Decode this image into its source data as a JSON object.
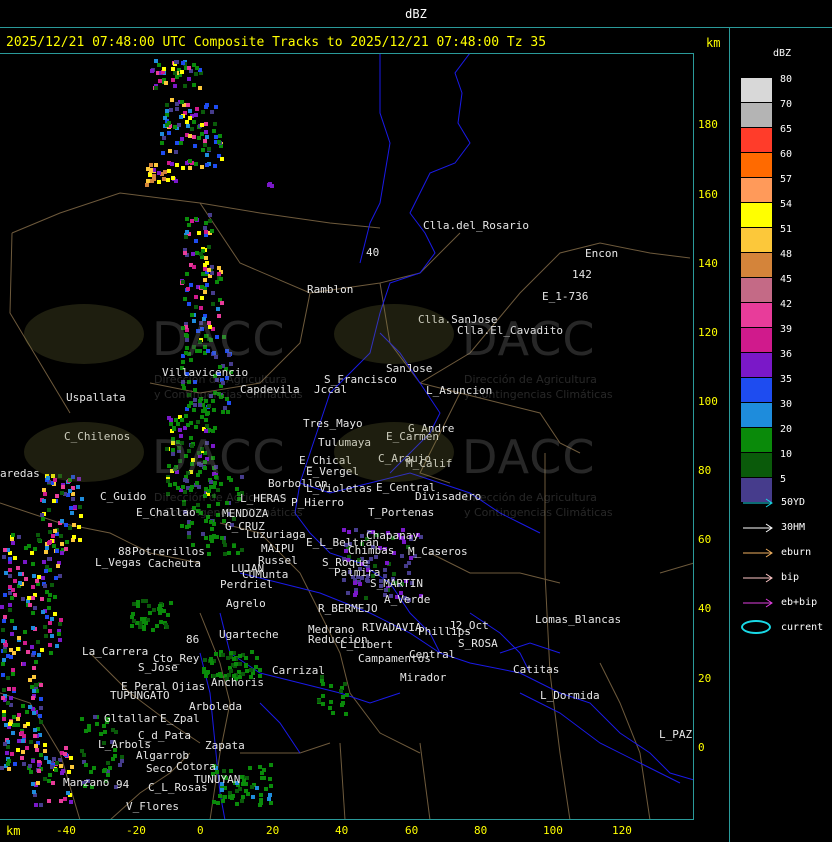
{
  "window_title": "dBZ",
  "header": "2025/12/21 07:48:00 UTC Composite Tracks to 2025/12/21 07:48:00 Tz 35",
  "km_label": "km",
  "y_ticks": [
    "180",
    "160",
    "140",
    "120",
    "100",
    "80",
    "60",
    "40",
    "20",
    "0"
  ],
  "x_ticks": [
    "-40",
    "-20",
    "0",
    "20",
    "40",
    "60",
    "80",
    "100",
    "120"
  ],
  "legend": {
    "title": "dBZ",
    "bins": [
      {
        "label": "80",
        "color": "#d8d8d8"
      },
      {
        "label": "70",
        "color": "#b4b4b4"
      },
      {
        "label": "65",
        "color": "#ff3c2a"
      },
      {
        "label": "60",
        "color": "#ff6a00"
      },
      {
        "label": "57",
        "color": "#ff9a5a"
      },
      {
        "label": "54",
        "color": "#ffff00"
      },
      {
        "label": "51",
        "color": "#fcc83a"
      },
      {
        "label": "48",
        "color": "#d4843a"
      },
      {
        "label": "45",
        "color": "#c46a86"
      },
      {
        "label": "42",
        "color": "#e83c9a"
      },
      {
        "label": "39",
        "color": "#d01a8c"
      },
      {
        "label": "36",
        "color": "#7a18c8"
      },
      {
        "label": "35",
        "color": "#1e4cf0"
      },
      {
        "label": "30",
        "color": "#1e8cdc"
      },
      {
        "label": "20",
        "color": "#0a8a0a"
      },
      {
        "label": "10",
        "color": "#0a5a0a"
      },
      {
        "label": "5",
        "color": "#463c8c"
      }
    ]
  },
  "tracks": [
    {
      "label": "50YD",
      "color": "#19d9e6"
    },
    {
      "label": "30HM",
      "color": "#ffffff"
    },
    {
      "label": "eburn",
      "color": "#f0b060"
    },
    {
      "label": "bip",
      "color": "#ffc8c8"
    },
    {
      "label": "eb+bip",
      "color": "#e040e0"
    }
  ],
  "current_label": "current",
  "watermark": {
    "brand": "DACC",
    "line1": "Dirección de Agricultura",
    "line2": "y Contingencias Climáticas"
  },
  "places": [
    {
      "name": "Clla.del_Rosario"
    },
    {
      "name": "Encon"
    },
    {
      "name": "142"
    },
    {
      "name": "E_1-736"
    },
    {
      "name": "Ramblon"
    },
    {
      "name": "Clla.SanJose"
    },
    {
      "name": "Clla.El_Cavadito"
    },
    {
      "name": "Villavicencio"
    },
    {
      "name": "S_Francisco"
    },
    {
      "name": "SanJose"
    },
    {
      "name": "Capdevila"
    },
    {
      "name": "Jccal"
    },
    {
      "name": "L_Asuncion"
    },
    {
      "name": "Uspallata"
    },
    {
      "name": "Tres_Mayo"
    },
    {
      "name": "G_Andre"
    },
    {
      "name": "E_Carmen"
    },
    {
      "name": "C_Chilenos"
    },
    {
      "name": "Tulumaya"
    },
    {
      "name": "C_Araujo"
    },
    {
      "name": "M_Calif"
    },
    {
      "name": "E_Chical"
    },
    {
      "name": "E_Vergel"
    },
    {
      "name": "aredas"
    },
    {
      "name": "Borbollon"
    },
    {
      "name": "L_Violetas"
    },
    {
      "name": "E_Central"
    },
    {
      "name": "Divisadero"
    },
    {
      "name": "C_Guido"
    },
    {
      "name": "L_HERAS"
    },
    {
      "name": "P_Hierro"
    },
    {
      "name": "E_Challao"
    },
    {
      "name": "MENDOZA"
    },
    {
      "name": "T_Portenas"
    },
    {
      "name": "G_CRUZ"
    },
    {
      "name": "Luzuriaga"
    },
    {
      "name": "Chapanay"
    },
    {
      "name": "E_L_Beltran"
    },
    {
      "name": "MAIPU"
    },
    {
      "name": "Chimbas"
    },
    {
      "name": "M_Caseros"
    },
    {
      "name": "Potrerillos"
    },
    {
      "name": "Cacheuta"
    },
    {
      "name": "Russel"
    },
    {
      "name": "S_Roque"
    },
    {
      "name": "L_Vegas"
    },
    {
      "name": "LUJAN"
    },
    {
      "name": "Palmira"
    },
    {
      "name": "CUMunta"
    },
    {
      "name": "S_MARTIN"
    },
    {
      "name": "Perdriel"
    },
    {
      "name": "A_Verde"
    },
    {
      "name": "Medrano"
    },
    {
      "name": "Agrelo"
    },
    {
      "name": "R_BERMEJO"
    },
    {
      "name": "RIVADAVIA"
    },
    {
      "name": "J2_Oct"
    },
    {
      "name": "Lomas_Blancas"
    },
    {
      "name": "Ugarteche"
    },
    {
      "name": "Reduccion"
    },
    {
      "name": "Phillips"
    },
    {
      "name": "S_ROSA"
    },
    {
      "name": "L_Libert"
    },
    {
      "name": "La_Carrera"
    },
    {
      "name": "Cto_Rey"
    },
    {
      "name": "Campamentos"
    },
    {
      "name": "Central"
    },
    {
      "name": "S_Jose"
    },
    {
      "name": "Carrizal"
    },
    {
      "name": "Catitas"
    },
    {
      "name": "E_Peral"
    },
    {
      "name": "Ojias"
    },
    {
      "name": "Anchoris"
    },
    {
      "name": "Mirador"
    },
    {
      "name": "TUPUNGATO"
    },
    {
      "name": "L_Dormida"
    },
    {
      "name": "Arboleda"
    },
    {
      "name": "Gltallar"
    },
    {
      "name": "E_Zpal"
    },
    {
      "name": "C_d_Pata"
    },
    {
      "name": "L_PAZ"
    },
    {
      "name": "L_Arbols"
    },
    {
      "name": "Zapata"
    },
    {
      "name": "Algarrob"
    },
    {
      "name": "Cotora"
    },
    {
      "name": "Seco"
    },
    {
      "name": "TUNUYAN"
    },
    {
      "name": "Manzano"
    },
    {
      "name": "94"
    },
    {
      "name": "C_L_Rosas"
    },
    {
      "name": "V_Flores"
    },
    {
      "name": "40"
    },
    {
      "name": "88"
    },
    {
      "name": "86"
    }
  ]
}
